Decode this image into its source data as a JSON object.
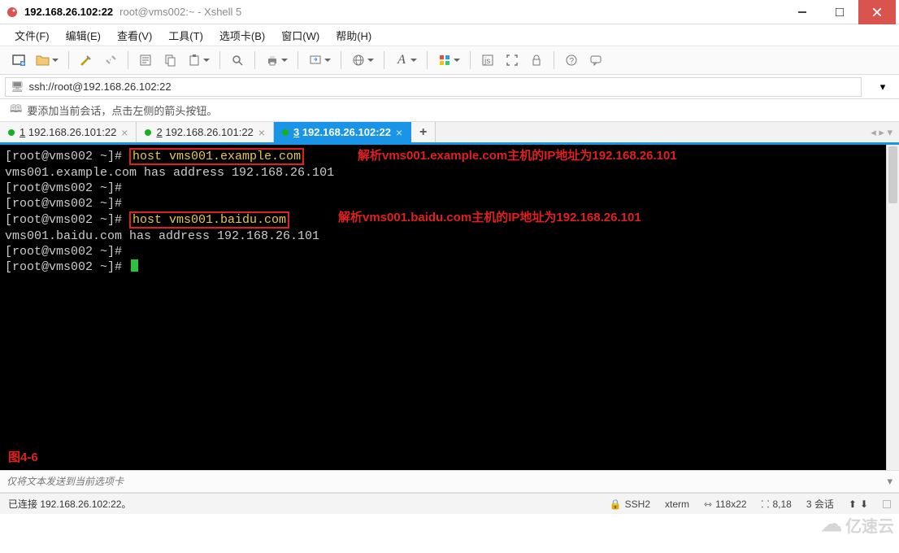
{
  "titlebar": {
    "main": "192.168.26.102:22",
    "sub": "root@vms002:~ - Xshell 5"
  },
  "menu": {
    "file": "文件(F)",
    "edit": "编辑(E)",
    "view": "查看(V)",
    "tools": "工具(T)",
    "tabs": "选项卡(B)",
    "window": "窗口(W)",
    "help": "帮助(H)"
  },
  "address": {
    "url": "ssh://root@192.168.26.102:22"
  },
  "hint": {
    "text": "要添加当前会话，点击左侧的箭头按钮。"
  },
  "tabs": {
    "items": [
      {
        "num": "1",
        "label": "192.168.26.101:22"
      },
      {
        "num": "2",
        "label": "192.168.26.101:22"
      },
      {
        "num": "3",
        "label": "192.168.26.102:22"
      }
    ],
    "plus": "+"
  },
  "terminal": {
    "prompt": "[root@vms002 ~]# ",
    "cmd1": "host vms001.example.com",
    "out1": "vms001.example.com has address 192.168.26.101",
    "cmd2": "host vms001.baidu.com",
    "out2": "vms001.baidu.com has address 192.168.26.101",
    "annot1": "解析vms001.example.com主机的IP地址为192.168.26.101",
    "annot2": "解析vms001.baidu.com主机的IP地址为192.168.26.101",
    "figlabel": "图4-6"
  },
  "compose": {
    "placeholder": "仅将文本发送到当前选项卡"
  },
  "status": {
    "conn": "已连接 192.168.26.102:22。",
    "proto": "SSH2",
    "term": "xterm",
    "size": "118x22",
    "pos": "8,18",
    "sess": "3 会话"
  },
  "watermark": {
    "text": "亿速云"
  }
}
